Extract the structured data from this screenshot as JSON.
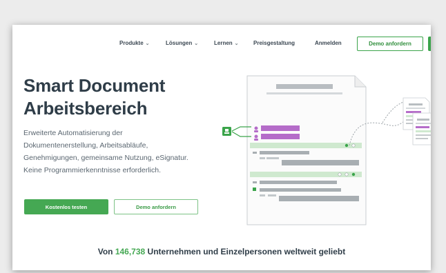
{
  "nav": {
    "items": [
      {
        "label": "Produkte",
        "dropdown": true
      },
      {
        "label": "Lösungen",
        "dropdown": true
      },
      {
        "label": "Lernen",
        "dropdown": true
      },
      {
        "label": "Preisgestaltung",
        "dropdown": false
      },
      {
        "label": "Anmelden",
        "dropdown": false
      }
    ],
    "demo_button": "Demo anfordern"
  },
  "hero": {
    "title_line1": "Smart Document",
    "title_line2": "Arbeitsbereich",
    "description": "Erweiterte Automatisierung der Dokumentenerstellung, Arbeitsabläufe, Genehmigungen, gemeinsame Nutzung, eSignatur. Keine Programmierkenntnisse erforderlich.",
    "primary_button": "Kostenlos testen",
    "secondary_button": "Demo anfordern"
  },
  "tagline": {
    "prefix": "Von ",
    "count": "146,738",
    "suffix": " Unternehmen und Einzelpersonen weltweit geliebt"
  },
  "colors": {
    "accent": "#45a853",
    "purple": "#b56cc9",
    "light_green": "#cfe9cf"
  },
  "icons": [
    "chevron-down-icon",
    "contact-card-icon",
    "person-icon",
    "check-icon"
  ]
}
